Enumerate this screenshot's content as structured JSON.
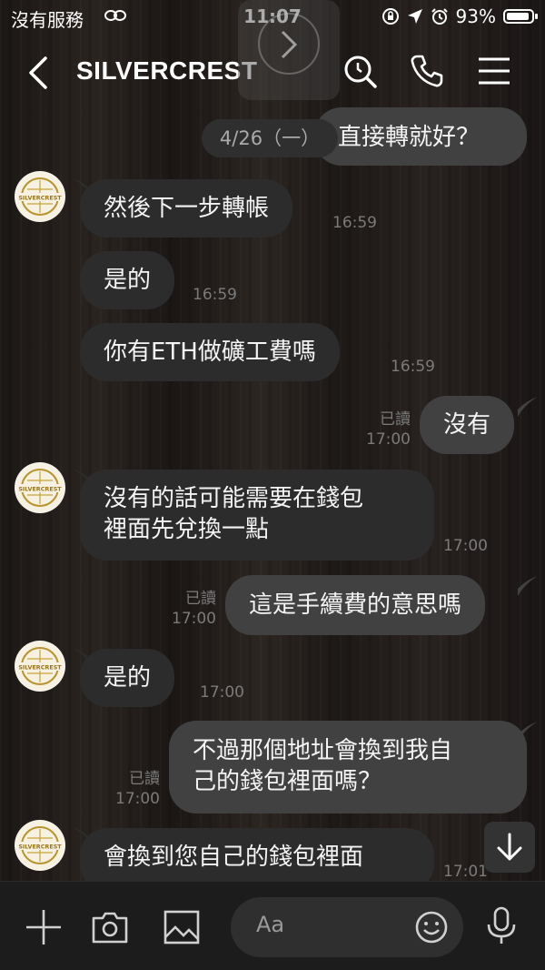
{
  "status_bar": {
    "carrier": "沒有服務",
    "time": "11:07",
    "battery": "93%",
    "battery_level": 0.93
  },
  "header": {
    "title": "SILVERCREST"
  },
  "date_divider": "4/26（一）",
  "contact_avatar_text": "SILVERCREST",
  "messages": [
    {
      "side": "right",
      "text": "直接轉就好？"
    },
    {
      "side": "left",
      "text": "然後下一步轉帳",
      "time": "16:59"
    },
    {
      "side": "left",
      "text": "是的",
      "time": "16:59"
    },
    {
      "side": "left",
      "text": "你有ETH做礦工費嗎",
      "time": "16:59"
    },
    {
      "side": "right",
      "text": "沒有",
      "read": "已讀",
      "time": "17:00"
    },
    {
      "side": "left",
      "line1": "沒有的話可能需要在錢包",
      "line2": "裡面先兌換一點",
      "time": "17:00"
    },
    {
      "side": "right",
      "text": "這是手續費的意思嗎",
      "read": "已讀",
      "time": "17:00"
    },
    {
      "side": "left",
      "text": "是的",
      "time": "17:00"
    },
    {
      "side": "right",
      "line1": "不過那個地址會換到我自",
      "line2": "己的錢包裡面嗎？",
      "read": "已讀",
      "time": "17:00"
    },
    {
      "side": "left",
      "text": "會換到您自己的錢包裡面",
      "time": "17:01"
    }
  ],
  "input": {
    "placeholder": "Aa"
  },
  "icons": {
    "back": "chevron-left-icon",
    "search": "search-clock-icon",
    "call": "phone-icon",
    "menu": "menu-icon",
    "add": "plus-icon",
    "camera": "camera-icon",
    "image": "image-icon",
    "emoji": "emoji-icon",
    "mic": "microphone-icon",
    "scroll": "arrow-down-icon"
  }
}
